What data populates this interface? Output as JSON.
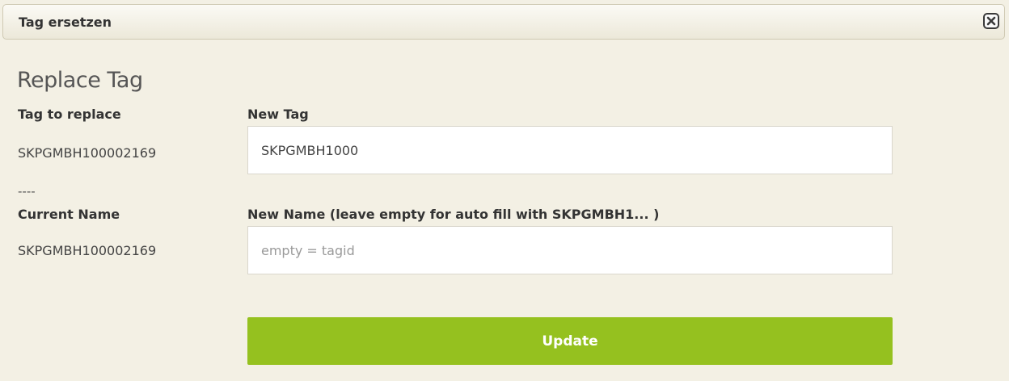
{
  "window": {
    "title": "Tag ersetzen",
    "close_icon": "close-icon"
  },
  "form": {
    "heading": "Replace Tag",
    "tag_to_replace_label": "Tag to replace",
    "tag_to_replace_value": "SKPGMBH100002169",
    "separator": "----",
    "current_name_label": "Current Name",
    "current_name_value": "SKPGMBH100002169",
    "new_tag_label": "New Tag",
    "new_tag_value": "SKPGMBH1000",
    "new_name_label": "New Name (leave empty for auto fill with SKPGMBH1... )",
    "new_name_value": "",
    "new_name_placeholder": "empty = tagid",
    "update_label": "Update"
  },
  "colors": {
    "background": "#f3f0e4",
    "button": "#95c11f",
    "button_text": "#ffffff"
  }
}
